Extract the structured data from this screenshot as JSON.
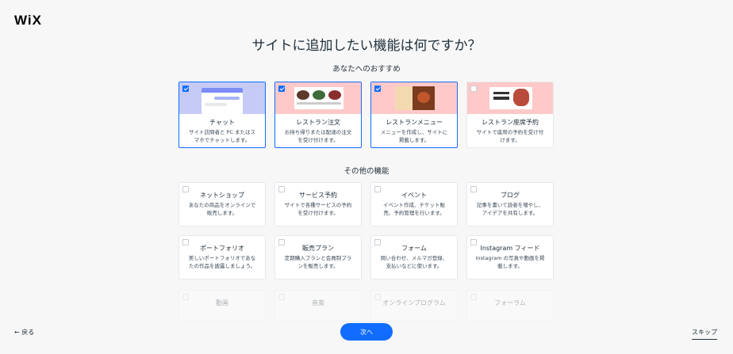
{
  "brand": {
    "logo": "WiX",
    "accent": "#116dff"
  },
  "title": "サイトに追加したい機能は何ですか？",
  "recommended": {
    "label": "あなたへのおすすめ",
    "items": [
      {
        "title": "チャット",
        "desc": "サイト訪問者と PC またはスマホでチャットします。",
        "checked": true,
        "bg": "#c5cbf5"
      },
      {
        "title": "レストラン注文",
        "desc": "お持ち帰りまたは配達の注文を受け付けます。",
        "checked": true,
        "bg": "#ffc9c9"
      },
      {
        "title": "レストランメニュー",
        "desc": "メニューを作成し、サイトに掲載します。",
        "checked": true,
        "bg": "#ffc9c9"
      },
      {
        "title": "レストラン座席予約",
        "desc": "サイトで座席の予約を受け付けます。",
        "checked": false,
        "bg": "#ffc9c9"
      }
    ]
  },
  "other": {
    "label": "その他の機能",
    "rows": [
      [
        {
          "title": "ネットショップ",
          "desc": "あなたの商品をオンラインで販売します。"
        },
        {
          "title": "サービス予約",
          "desc": "サイトで各種サービスの予約を受け付けます。"
        },
        {
          "title": "イベント",
          "desc": "イベント作成、チケット販売、予約管理を行います。"
        },
        {
          "title": "ブログ",
          "desc": "記事を書いて読者を増やし、アイデアを共有します。"
        }
      ],
      [
        {
          "title": "ポートフォリオ",
          "desc": "美しいポートフォリオであなたの作品を披露しましょう。"
        },
        {
          "title": "販売プラン",
          "desc": "定期購入プランと会員制プランを販売します。"
        },
        {
          "title": "フォーム",
          "desc": "問い合わせ、メルマガ登録、支払いなどに使います。"
        },
        {
          "title": "Instagram フィード",
          "desc": "Instagram の写真や動画を掲載します。"
        }
      ],
      [
        {
          "title": "動画",
          "desc": ""
        },
        {
          "title": "音楽",
          "desc": ""
        },
        {
          "title": "オンラインプログラム",
          "desc": ""
        },
        {
          "title": "フォーラム",
          "desc": ""
        }
      ]
    ]
  },
  "footer": {
    "back": "← 戻る",
    "next": "次へ",
    "skip": "スキップ"
  }
}
